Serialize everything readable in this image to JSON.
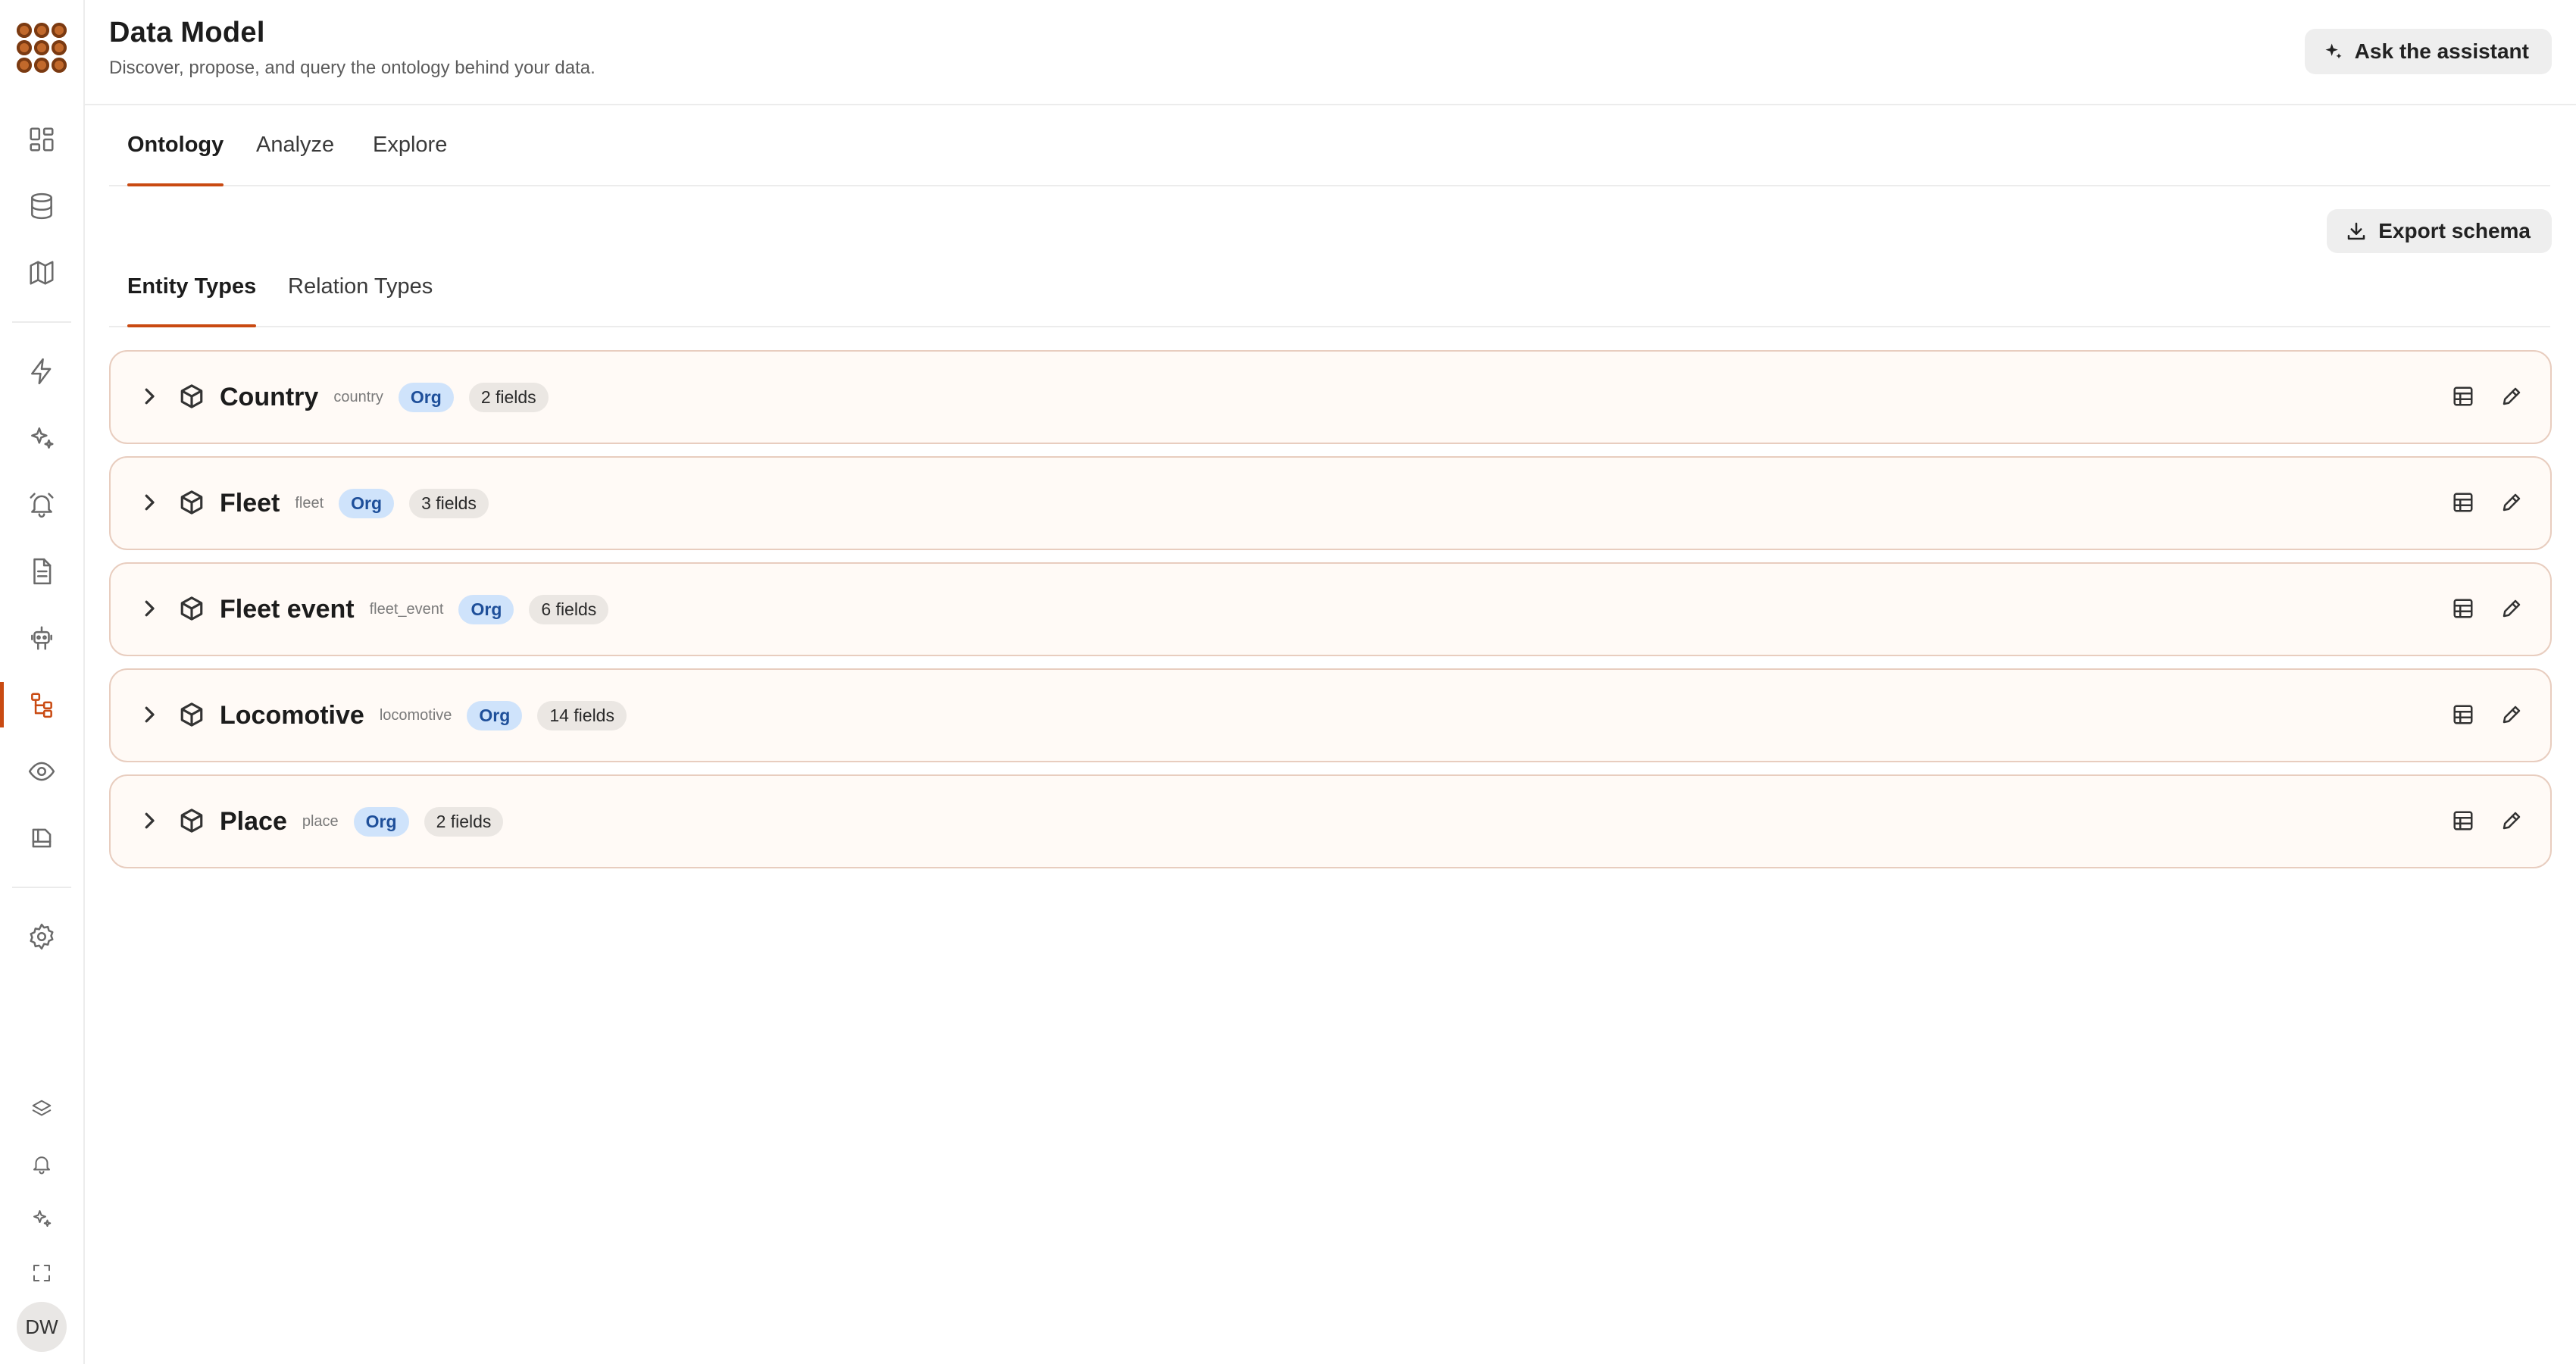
{
  "header": {
    "title": "Data Model",
    "subtitle": "Discover, propose, and query the ontology behind your data.",
    "assistant_label": "Ask the assistant"
  },
  "main_tabs": [
    {
      "label": "Ontology",
      "active": true
    },
    {
      "label": "Analyze",
      "active": false
    },
    {
      "label": "Explore",
      "active": false
    }
  ],
  "toolbar": {
    "export_label": "Export schema"
  },
  "sub_tabs": [
    {
      "label": "Entity Types",
      "active": true
    },
    {
      "label": "Relation Types",
      "active": false
    }
  ],
  "entities": [
    {
      "name": "Country",
      "key": "country",
      "scope": "Org",
      "fields": "2 fields"
    },
    {
      "name": "Fleet",
      "key": "fleet",
      "scope": "Org",
      "fields": "3 fields"
    },
    {
      "name": "Fleet event",
      "key": "fleet_event",
      "scope": "Org",
      "fields": "6 fields"
    },
    {
      "name": "Locomotive",
      "key": "locomotive",
      "scope": "Org",
      "fields": "14 fields"
    },
    {
      "name": "Place",
      "key": "place",
      "scope": "Org",
      "fields": "2 fields"
    }
  ],
  "sidebar": {
    "items": [
      {
        "icon": "dashboard-icon"
      },
      {
        "icon": "database-icon"
      },
      {
        "icon": "map-icon"
      },
      {
        "icon": "lightning-icon"
      },
      {
        "icon": "sparkles-icon"
      },
      {
        "icon": "alarm-icon"
      },
      {
        "icon": "document-icon"
      },
      {
        "icon": "robot-icon"
      },
      {
        "icon": "data-model-icon",
        "active": true
      },
      {
        "icon": "eye-icon"
      },
      {
        "icon": "notebook-icon"
      },
      {
        "icon": "settings-icon"
      }
    ],
    "bottom_items": [
      {
        "icon": "layers-icon"
      },
      {
        "icon": "bell-icon"
      },
      {
        "icon": "sparkles-icon"
      },
      {
        "icon": "fullscreen-icon"
      }
    ],
    "user_initials": "DW"
  },
  "colors": {
    "accent": "#c94a12",
    "card_background": "#fffaf6",
    "card_border": "#e8cdbf",
    "org_badge_bg": "#cfe3fb"
  }
}
